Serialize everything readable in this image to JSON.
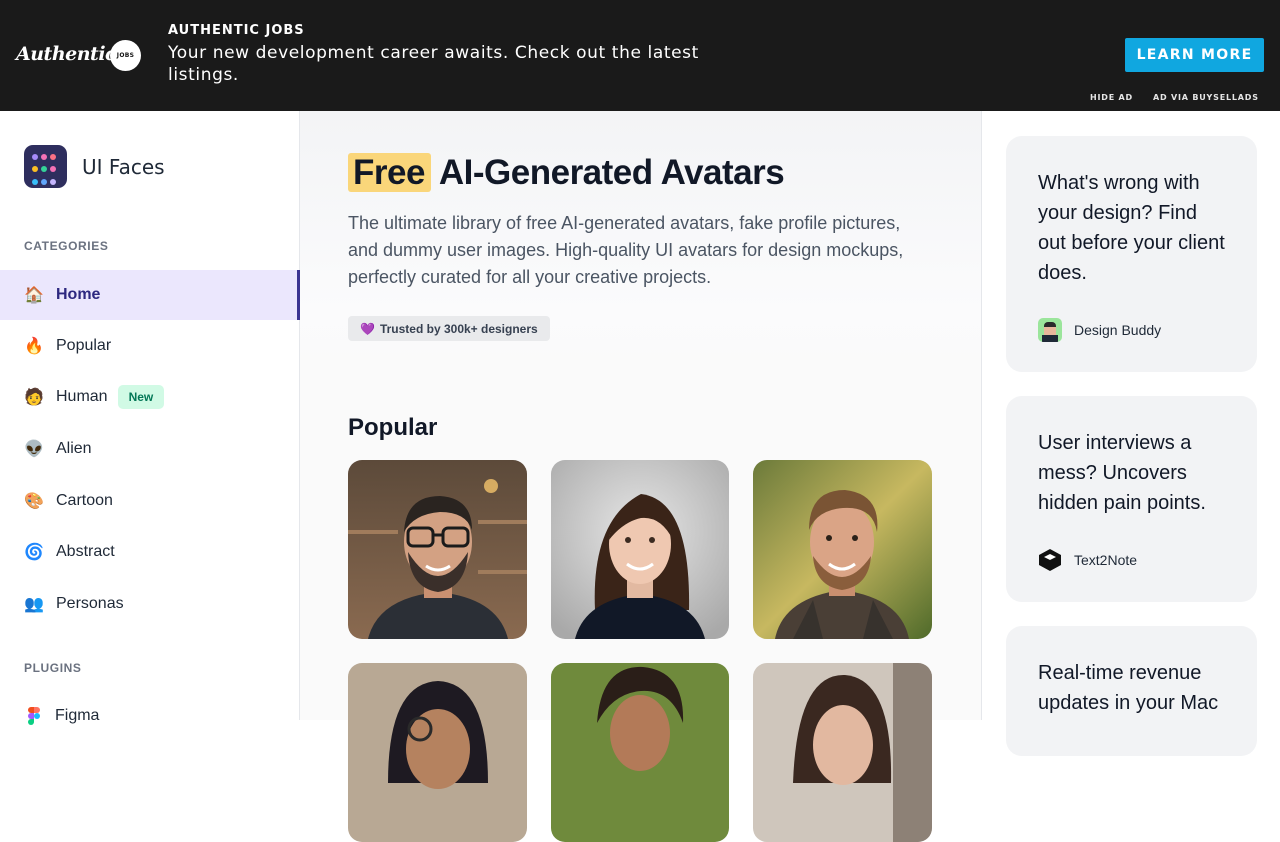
{
  "ad": {
    "logo_text": "Authentic",
    "badge_text": "JOBS",
    "kicker": "AUTHENTIC JOBS",
    "text": "Your new development career awaits. Check out the latest listings.",
    "cta": "LEARN MORE",
    "hide": "HIDE AD",
    "via": "AD VIA BUYSELLADS",
    "cta_color": "#10a7e0"
  },
  "sidebar": {
    "brand": "UI Faces",
    "categories_label": "CATEGORIES",
    "items": [
      {
        "label": "Home",
        "emoji": "🏠",
        "active": true
      },
      {
        "label": "Popular",
        "emoji": "🔥"
      },
      {
        "label": "Human",
        "emoji": "🧑",
        "badge": "New"
      },
      {
        "label": "Alien",
        "emoji": "👽"
      },
      {
        "label": "Cartoon",
        "emoji": "🎨"
      },
      {
        "label": "Abstract",
        "emoji": "🌀"
      },
      {
        "label": "Personas",
        "emoji": "👥"
      }
    ],
    "plugins_label": "PLUGINS",
    "plugins": [
      {
        "label": "Figma",
        "icon": "figma-icon"
      }
    ]
  },
  "hero": {
    "title_highlight": "Free",
    "title_rest": "AI-Generated Avatars",
    "subtitle": "The ultimate library of free AI-generated avatars, fake profile pictures, and dummy user images. High-quality UI avatars for design mockups, perfectly curated for all your creative projects.",
    "trust_icon": "💜",
    "trust": "Trusted by 300k+ designers",
    "accent": "#fad67a"
  },
  "popular": {
    "title": "Popular"
  },
  "rail": {
    "cards": [
      {
        "text": "What's wrong with your design? Find out before your client does.",
        "brand": "Design Buddy"
      },
      {
        "text": "User interviews a mess? Uncovers hidden pain points.",
        "brand": "Text2Note"
      },
      {
        "text": "Real-time revenue updates in your Mac",
        "brand": ""
      }
    ]
  }
}
